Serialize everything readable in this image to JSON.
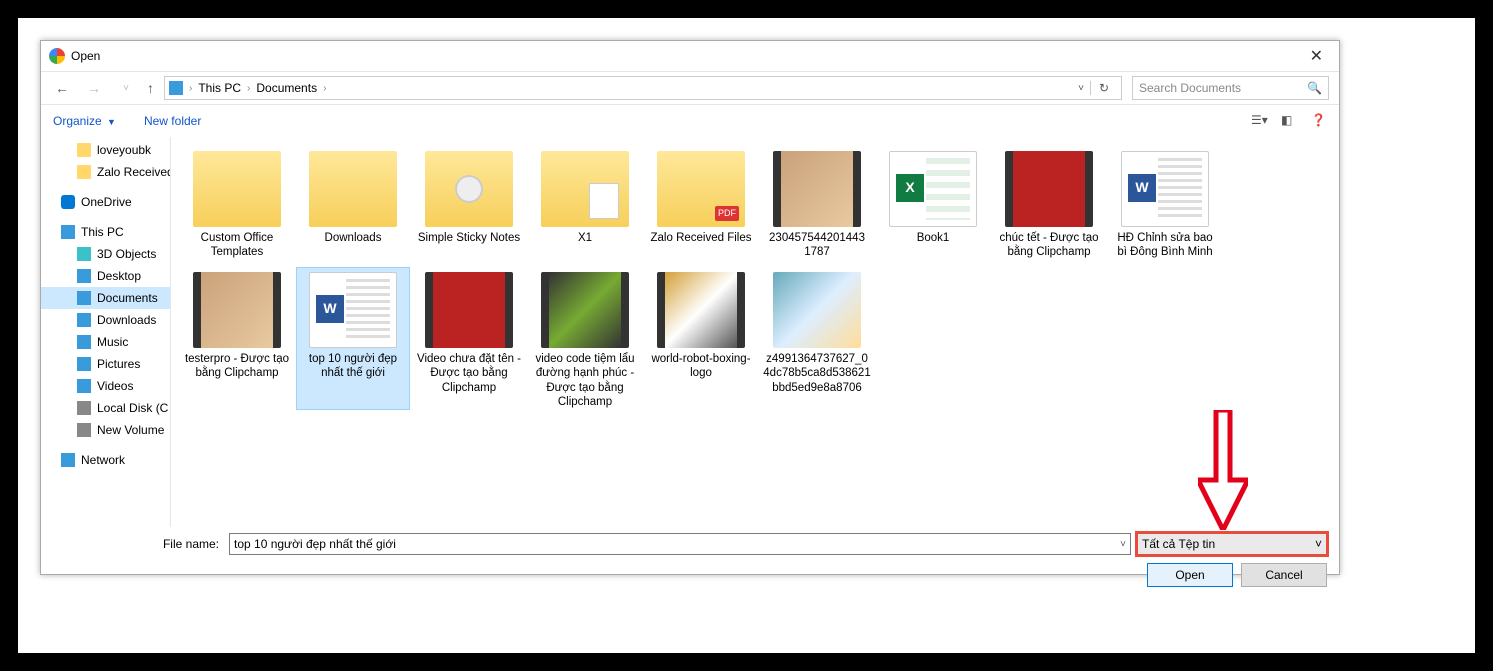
{
  "title": "Open",
  "close": "✕",
  "breadcrumb": {
    "root": "This PC",
    "folder": "Documents"
  },
  "search": {
    "placeholder": "Search Documents"
  },
  "toolbar": {
    "organize": "Organize",
    "newfolder": "New folder"
  },
  "sidebar": {
    "loveyoubk": "loveyoubk",
    "zalorecv": "Zalo Received",
    "onedrive": "OneDrive",
    "thispc": "This PC",
    "obj3d": "3D Objects",
    "desktop": "Desktop",
    "documents": "Documents",
    "downloads": "Downloads",
    "music": "Music",
    "pictures": "Pictures",
    "videos": "Videos",
    "localdisk": "Local Disk (C",
    "newvol": "New Volume",
    "network": "Network"
  },
  "files": {
    "f0": "Custom Office Templates",
    "f1": "Downloads",
    "f2": "Simple Sticky Notes",
    "f3": "X1",
    "f4": "Zalo Received Files",
    "f5": "230457544201443 1787",
    "f6": "Book1",
    "f7": "chúc tết - Được tạo bằng Clipchamp",
    "f8": "HĐ Chỉnh sửa bao bì Đông Bình Minh",
    "f9": "testerpro - Được tạo bằng Clipchamp",
    "f10": "top 10 người đẹp nhất thế giới",
    "f11": "Video chưa đặt tên - Được tạo bằng Clipchamp",
    "f12": "video code tiệm lẩu đường hạnh phúc - Được tạo bằng Clipchamp",
    "f13": "world-robot-boxing-logo",
    "f14": "z4991364737627_04dc78b5ca8d538621bbd5ed9e8a8706"
  },
  "filename": {
    "label": "File name:",
    "value": "top 10 người đẹp nhất thế giới"
  },
  "filter": "Tất cả Tệp tin",
  "buttons": {
    "open": "Open",
    "cancel": "Cancel"
  }
}
